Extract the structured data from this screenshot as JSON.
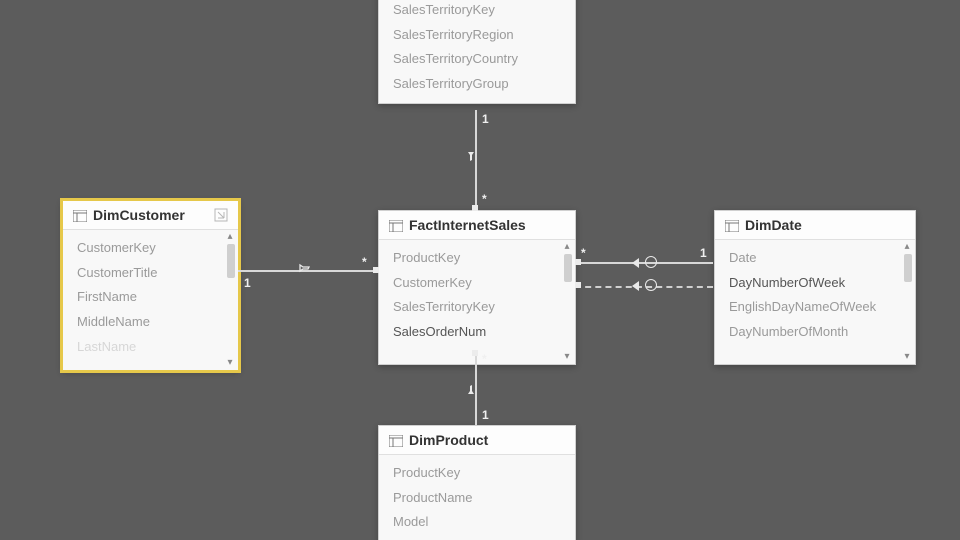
{
  "tables": {
    "territory": {
      "title": "",
      "fields": [
        "SalesTerritoryKey",
        "SalesTerritoryRegion",
        "SalesTerritoryCountry",
        "SalesTerritoryGroup"
      ]
    },
    "customer": {
      "title": "DimCustomer",
      "fields": [
        "CustomerKey",
        "CustomerTitle",
        "FirstName",
        "MiddleName",
        "LastName"
      ]
    },
    "fact": {
      "title": "FactInternetSales",
      "fields": [
        "ProductKey",
        "CustomerKey",
        "SalesTerritoryKey",
        "SalesOrderNum"
      ]
    },
    "date": {
      "title": "DimDate",
      "fields": [
        "Date",
        "DayNumberOfWeek",
        "EnglishDayNameOfWeek",
        "DayNumberOfMonth"
      ]
    },
    "product": {
      "title": "DimProduct",
      "fields": [
        "ProductKey",
        "ProductName",
        "Model"
      ]
    }
  },
  "cardinality": {
    "one": "1",
    "many": "*"
  }
}
